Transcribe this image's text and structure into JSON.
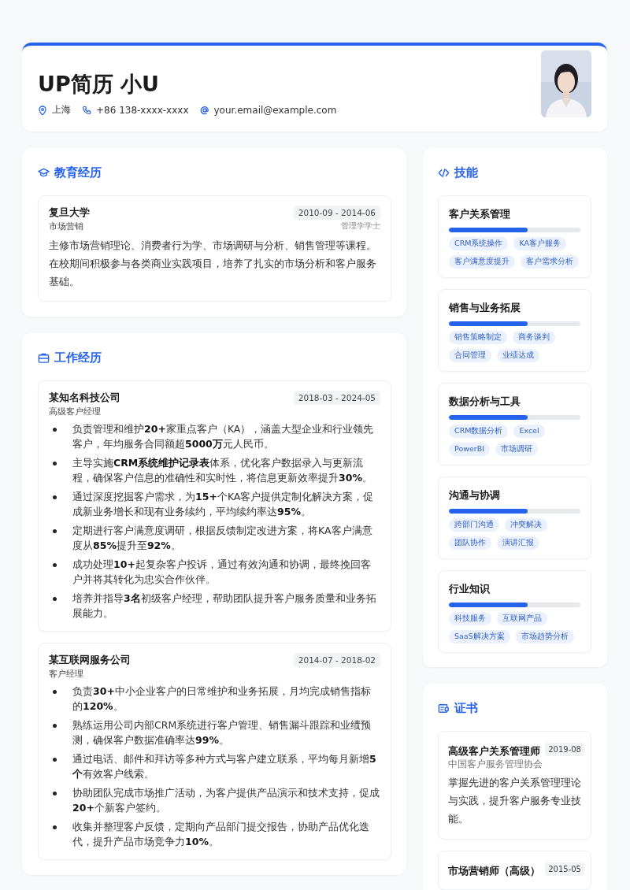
{
  "header": {
    "name": "UP简历 小U",
    "contacts": [
      {
        "kind": "location",
        "text": "上海"
      },
      {
        "kind": "phone",
        "text": "+86 138-xxxx-xxxx"
      },
      {
        "kind": "email",
        "text": "your.email@example.com"
      }
    ]
  },
  "education": {
    "title": "教育经历",
    "items": [
      {
        "school": "复旦大学",
        "dates": "2010-09 - 2014-06",
        "major": "市场营销",
        "degree": "管理学学士",
        "description": "主修市场营销理论、消费者行为学、市场调研与分析、销售管理等课程。在校期间积极参与各类商业实践项目，培养了扎实的市场分析和客户服务基础。"
      }
    ]
  },
  "work": {
    "title": "工作经历",
    "items": [
      {
        "company": "某知名科技公司",
        "dates": "2018-03 - 2024-05",
        "role": "高级客户经理",
        "bullets": [
          "负责管理和维护**20+**家重点客户（KA），涵盖大型企业和行业领先客户，年均服务合同额超**5000万**元人民币。",
          "主导实施**CRM系统维护记录表**体系，优化客户数据录入与更新流程，确保客户信息的准确性和实时性，将信息更新效率提升**30%**。",
          "通过深度挖掘客户需求，为**15+**个KA客户提供定制化解决方案，促成新业务增长和现有业务续约，平均续约率达**95%**。",
          "定期进行客户满意度调研，根据反馈制定改进方案，将KA客户满意度从**85%**提升至**92%**。",
          "成功处理**10+**起复杂客户投诉，通过有效沟通和协调，最终挽回客户并将其转化为忠实合作伙伴。",
          "培养并指导**3名**初级客户经理，帮助团队提升客户服务质量和业务拓展能力。"
        ]
      },
      {
        "company": "某互联网服务公司",
        "dates": "2014-07 - 2018-02",
        "role": "客户经理",
        "bullets": [
          "负责**30+**中小企业客户的日常维护和业务拓展，月均完成销售指标的**120%**。",
          "熟练运用公司内部CRM系统进行客户管理、销售漏斗跟踪和业绩预测，确保客户数据准确率达**99%**。",
          "通过电话、邮件和拜访等多种方式与客户建立联系，平均每月新增**5个**有效客户线索。",
          "协助团队完成市场推广活动，为客户提供产品演示和技术支持，促成**20+**个新客户签约。",
          "收集并整理客户反馈，定期向产品部门提交报告，协助产品优化迭代，提升产品市场竞争力**10%**。"
        ]
      }
    ]
  },
  "skills": {
    "title": "技能",
    "items": [
      {
        "name": "客户关系管理",
        "level": 0.6,
        "tags": [
          "CRM系统操作",
          "KA客户服务",
          "客户满意度提升",
          "客户需求分析"
        ]
      },
      {
        "name": "销售与业务拓展",
        "level": 0.6,
        "tags": [
          "销售策略制定",
          "商务谈判",
          "合同管理",
          "业绩达成"
        ]
      },
      {
        "name": "数据分析与工具",
        "level": 0.6,
        "tags": [
          "CRM数据分析",
          "Excel",
          "PowerBI",
          "市场调研"
        ]
      },
      {
        "name": "沟通与协调",
        "level": 0.6,
        "tags": [
          "跨部门沟通",
          "冲突解决",
          "团队协作",
          "演讲汇报"
        ]
      },
      {
        "name": "行业知识",
        "level": 0.6,
        "tags": [
          "科技服务",
          "互联网产品",
          "SaaS解决方案",
          "市场趋势分析"
        ]
      }
    ]
  },
  "certificates": {
    "title": "证书",
    "items": [
      {
        "name": "高级客户关系管理师",
        "date": "2019-08",
        "issuer": "中国客户服务管理协会",
        "description": "掌握先进的客户关系管理理论与实践，提升客户服务专业技能。"
      },
      {
        "name": "市场营销师（高级）",
        "date": "2015-05"
      }
    ]
  }
}
